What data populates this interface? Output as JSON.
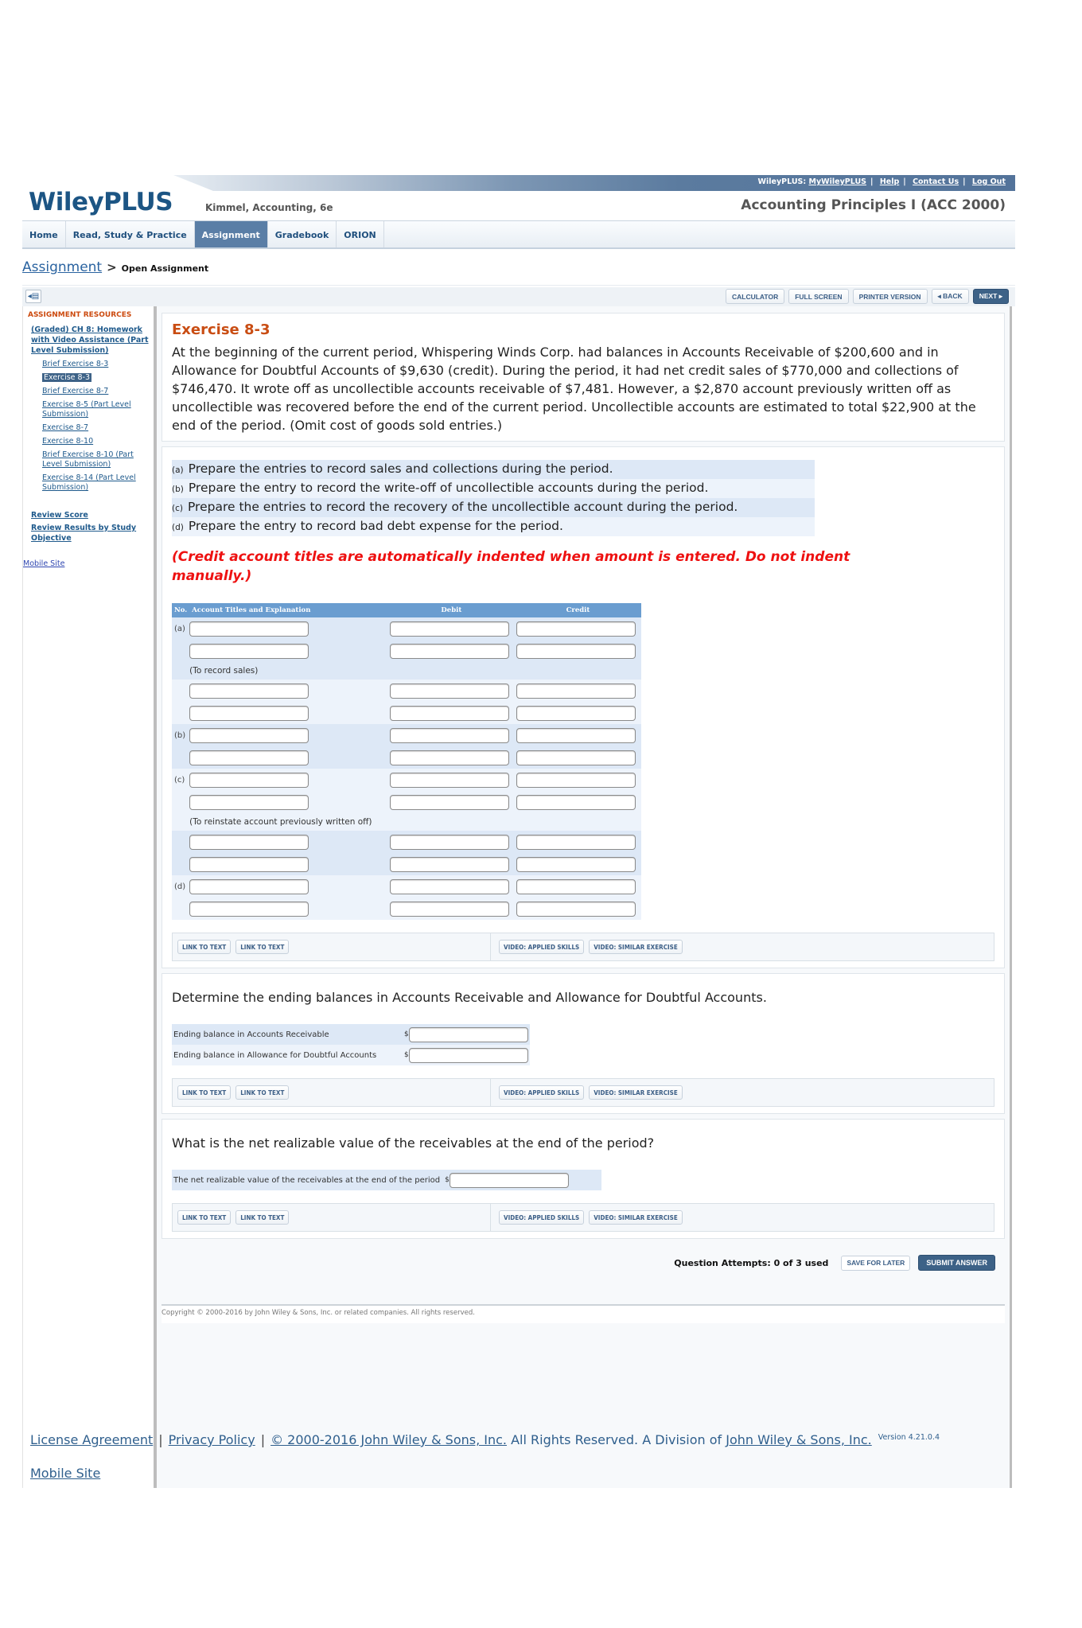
{
  "header": {
    "top_prefix": "WileyPLUS:",
    "top_links": [
      "MyWileyPLUS",
      "Help",
      "Contact Us",
      "Log Out"
    ],
    "logo": "WileyPLUS",
    "book_title": "Kimmel, Accounting, 6e",
    "course_title": "Accounting Principles I (ACC 2000)"
  },
  "nav": {
    "tabs": [
      "Home",
      "Read, Study & Practice",
      "Assignment",
      "Gradebook",
      "ORION"
    ],
    "active": "Assignment"
  },
  "breadcrumb": {
    "link": "Assignment",
    "separator": ">",
    "current": "Open Assignment"
  },
  "toolbar": {
    "calculator": "CALCULATOR",
    "full_screen": "FULL SCREEN",
    "printer_version": "PRINTER VERSION",
    "back": "◂ BACK",
    "next": "NEXT ▸"
  },
  "sidebar": {
    "heading": "ASSIGNMENT RESOURCES",
    "assignment": "(Graded) CH 8: Homework with Video Assistance (Part Level Submission)",
    "items": [
      {
        "label": "Brief Exercise 8-3",
        "selected": false
      },
      {
        "label": "Exercise 8-3",
        "selected": true
      },
      {
        "label": "Brief Exercise 8-7",
        "selected": false
      },
      {
        "label": "Exercise 8-5 (Part Level Submission)",
        "selected": false
      },
      {
        "label": "Exercise 8-7",
        "selected": false
      },
      {
        "label": "Exercise 8-10",
        "selected": false
      },
      {
        "label": "Brief Exercise 8-10 (Part Level Submission)",
        "selected": false
      },
      {
        "label": "Exercise 8-14 (Part Level Submission)",
        "selected": false
      }
    ],
    "review_score": "Review Score",
    "review_results": "Review Results by Study Objective",
    "mobile_site": "Mobile Site"
  },
  "exercise": {
    "title": "Exercise 8-3",
    "problem": "At the beginning of the current period, Whispering Winds Corp. had balances in Accounts Receivable of $200,600 and in Allowance for Doubtful Accounts of $9,630 (credit). During the period, it had net credit sales of $770,000 and collections of $746,470. It wrote off as uncollectible accounts receivable of $7,481. However, a $2,870 account previously written off as uncollectible was recovered before the end of the current period. Uncollectible accounts are estimated to total $22,900 at the end of the period. (Omit cost of goods sold entries.)",
    "parts": [
      {
        "label": "(a)",
        "text": "Prepare the entries to record sales and collections during the period."
      },
      {
        "label": "(b)",
        "text": "Prepare the entry to record the write-off of uncollectible accounts during the period."
      },
      {
        "label": "(c)",
        "text": "Prepare the entries to record the recovery of the uncollectible account during the period."
      },
      {
        "label": "(d)",
        "text": "Prepare the entry to record bad debt expense for the period."
      }
    ],
    "note": "(Credit account titles are automatically indented when amount is entered. Do not indent manually.)"
  },
  "journal": {
    "headers": {
      "no": "No.",
      "account": "Account Titles and Explanation",
      "debit": "Debit",
      "credit": "Credit"
    },
    "explanations": {
      "sales": "(To record sales)",
      "reinstate": "(To reinstate account previously written off)"
    },
    "labels": {
      "a": "(a)",
      "b": "(b)",
      "c": "(c)",
      "d": "(d)"
    }
  },
  "resource_buttons": {
    "link_to_text": "LINK TO TEXT",
    "video_applied": "VIDEO: APPLIED SKILLS",
    "video_similar": "VIDEO: SIMILAR EXERCISE"
  },
  "part2": {
    "question": "Determine the ending balances in Accounts Receivable and Allowance for Doubtful Accounts.",
    "fields": [
      {
        "label": "Ending balance in Accounts Receivable",
        "currency": "$",
        "value": ""
      },
      {
        "label": "Ending balance in Allowance for Doubtful Accounts",
        "currency": "$",
        "value": ""
      }
    ]
  },
  "part3": {
    "question": "What is the net realizable value of the receivables at the end of the period?",
    "field": {
      "label": "The net realizable value of the receivables at the end of the period",
      "currency": "$",
      "value": ""
    }
  },
  "submit": {
    "attempts": "Question Attempts: 0 of 3 used",
    "save": "SAVE FOR LATER",
    "submit": "SUBMIT ANSWER"
  },
  "copyright_inner": "Copyright © 2000-2016 by John Wiley & Sons, Inc. or related companies. All rights reserved.",
  "footer": {
    "license": "License Agreement",
    "privacy": "Privacy Policy",
    "copyright_link": "© 2000-2016 John Wiley & Sons, Inc.",
    "rights": " All Rights Reserved. A Division of ",
    "division_link": "John Wiley & Sons, Inc.",
    "version": "Version 4.21.0.4",
    "mobile": "Mobile Site",
    "sep": "|"
  }
}
